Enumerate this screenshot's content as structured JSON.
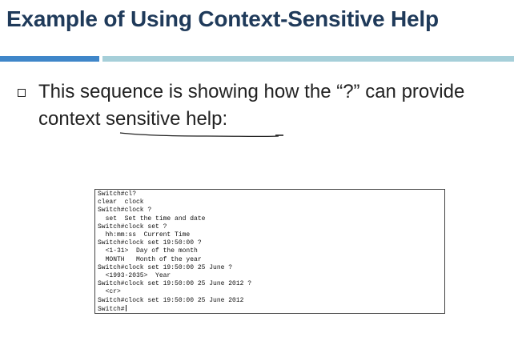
{
  "slide": {
    "title": "Example of Using Context-Sensitive Help",
    "bullet_text": "This sequence is showing how the “?” can provide context sensitive help:"
  },
  "terminal": {
    "lines": [
      "Switch#cl?",
      "clear  clock",
      "Switch#clock ?",
      "  set  Set the time and date",
      "Switch#clock set ?",
      "  hh:mm:ss  Current Time",
      "Switch#clock set 19:50:00 ?",
      "  <1-31>  Day of the month",
      "  MONTH   Month of the year",
      "Switch#clock set 19:50:00 25 June ?",
      "  <1993-2035>  Year",
      "Switch#clock set 19:50:00 25 June 2012 ?",
      "  <cr>",
      "Switch#clock set 19:50:00 25 June 2012",
      "Switch#"
    ]
  },
  "colors": {
    "title": "#1f3a5a",
    "rule_left": "#3f86c9",
    "rule_right": "#a6cfd9",
    "text": "#222222"
  }
}
